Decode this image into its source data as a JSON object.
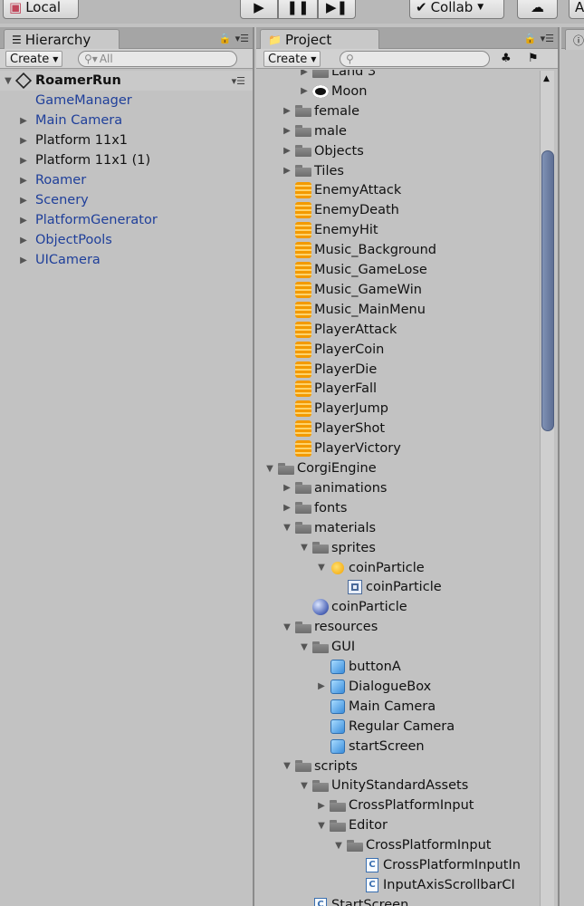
{
  "toolbar": {
    "local_label": "Local",
    "collab_label": "Collab",
    "account_label": "A"
  },
  "hierarchy": {
    "tab_label": "Hierarchy",
    "create_label": "Create",
    "search_placeholder": "All",
    "scene_name": "RoamerRun",
    "items": [
      {
        "label": "GameManager",
        "prefab": true,
        "expandable": false
      },
      {
        "label": "Main Camera",
        "prefab": true,
        "expandable": true
      },
      {
        "label": "Platform 11x1",
        "prefab": false,
        "expandable": true
      },
      {
        "label": "Platform 11x1 (1)",
        "prefab": false,
        "expandable": true
      },
      {
        "label": "Roamer",
        "prefab": true,
        "expandable": true
      },
      {
        "label": "Scenery",
        "prefab": true,
        "expandable": true
      },
      {
        "label": "PlatformGenerator",
        "prefab": true,
        "expandable": true
      },
      {
        "label": "ObjectPools",
        "prefab": true,
        "expandable": true
      },
      {
        "label": "UICamera",
        "prefab": true,
        "expandable": true
      }
    ]
  },
  "project": {
    "tab_label": "Project",
    "create_label": "Create",
    "tree": [
      {
        "label": "Land 3",
        "depth": 1,
        "icon": "folder",
        "arrow": "right"
      },
      {
        "label": "Moon",
        "depth": 1,
        "icon": "moon",
        "arrow": "right"
      },
      {
        "label": "female",
        "depth": 0,
        "icon": "folder",
        "arrow": "right"
      },
      {
        "label": "male",
        "depth": 0,
        "icon": "folder",
        "arrow": "right"
      },
      {
        "label": "Objects",
        "depth": 0,
        "icon": "folder",
        "arrow": "right"
      },
      {
        "label": "Tiles",
        "depth": 0,
        "icon": "folder",
        "arrow": "right"
      },
      {
        "label": "EnemyAttack",
        "depth": 0,
        "icon": "audio",
        "arrow": "none"
      },
      {
        "label": "EnemyDeath",
        "depth": 0,
        "icon": "audio",
        "arrow": "none"
      },
      {
        "label": "EnemyHit",
        "depth": 0,
        "icon": "audio",
        "arrow": "none"
      },
      {
        "label": "Music_Background",
        "depth": 0,
        "icon": "audio",
        "arrow": "none"
      },
      {
        "label": "Music_GameLose",
        "depth": 0,
        "icon": "audio",
        "arrow": "none"
      },
      {
        "label": "Music_GameWin",
        "depth": 0,
        "icon": "audio",
        "arrow": "none"
      },
      {
        "label": "Music_MainMenu",
        "depth": 0,
        "icon": "audio",
        "arrow": "none"
      },
      {
        "label": "PlayerAttack",
        "depth": 0,
        "icon": "audio",
        "arrow": "none"
      },
      {
        "label": "PlayerCoin",
        "depth": 0,
        "icon": "audio",
        "arrow": "none"
      },
      {
        "label": "PlayerDie",
        "depth": 0,
        "icon": "audio",
        "arrow": "none"
      },
      {
        "label": "PlayerFall",
        "depth": 0,
        "icon": "audio",
        "arrow": "none"
      },
      {
        "label": "PlayerJump",
        "depth": 0,
        "icon": "audio",
        "arrow": "none"
      },
      {
        "label": "PlayerShot",
        "depth": 0,
        "icon": "audio",
        "arrow": "none"
      },
      {
        "label": "PlayerVictory",
        "depth": 0,
        "icon": "audio",
        "arrow": "none"
      },
      {
        "label": "CorgiEngine",
        "depth": -1,
        "icon": "folder",
        "arrow": "down"
      },
      {
        "label": "animations",
        "depth": 0,
        "icon": "folder",
        "arrow": "right"
      },
      {
        "label": "fonts",
        "depth": 0,
        "icon": "folder",
        "arrow": "right"
      },
      {
        "label": "materials",
        "depth": 0,
        "icon": "folder",
        "arrow": "down"
      },
      {
        "label": "sprites",
        "depth": 1,
        "icon": "folder",
        "arrow": "down"
      },
      {
        "label": "coinParticle",
        "depth": 2,
        "icon": "coin",
        "arrow": "down"
      },
      {
        "label": "coinParticle",
        "depth": 3,
        "icon": "sprite",
        "arrow": "none"
      },
      {
        "label": "coinParticle",
        "depth": 1,
        "icon": "sphere",
        "arrow": "none"
      },
      {
        "label": "resources",
        "depth": 0,
        "icon": "folder",
        "arrow": "down"
      },
      {
        "label": "GUI",
        "depth": 1,
        "icon": "folder",
        "arrow": "down"
      },
      {
        "label": "buttonA",
        "depth": 2,
        "icon": "cube",
        "arrow": "none"
      },
      {
        "label": "DialogueBox",
        "depth": 2,
        "icon": "cube",
        "arrow": "right"
      },
      {
        "label": "Main Camera",
        "depth": 2,
        "icon": "cube",
        "arrow": "none"
      },
      {
        "label": "Regular Camera",
        "depth": 2,
        "icon": "cube",
        "arrow": "none"
      },
      {
        "label": "startScreen",
        "depth": 2,
        "icon": "cube",
        "arrow": "none"
      },
      {
        "label": "scripts",
        "depth": 0,
        "icon": "folder",
        "arrow": "down"
      },
      {
        "label": "UnityStandardAssets",
        "depth": 1,
        "icon": "folder",
        "arrow": "down"
      },
      {
        "label": "CrossPlatformInput",
        "depth": 2,
        "icon": "folder",
        "arrow": "right"
      },
      {
        "label": "Editor",
        "depth": 2,
        "icon": "folder",
        "arrow": "down"
      },
      {
        "label": "CrossPlatformInput",
        "depth": 3,
        "icon": "folder",
        "arrow": "down"
      },
      {
        "label": "CrossPlatformInputIn",
        "depth": 4,
        "icon": "script",
        "arrow": "none"
      },
      {
        "label": "InputAxisScrollbarCI",
        "depth": 4,
        "icon": "script",
        "arrow": "none"
      },
      {
        "label": "StartScreen",
        "depth": 1,
        "icon": "script",
        "arrow": "none"
      }
    ]
  },
  "colors": {
    "prefab_text": "#1f3f9a",
    "scroll_thumb": "#6b7ca3"
  }
}
